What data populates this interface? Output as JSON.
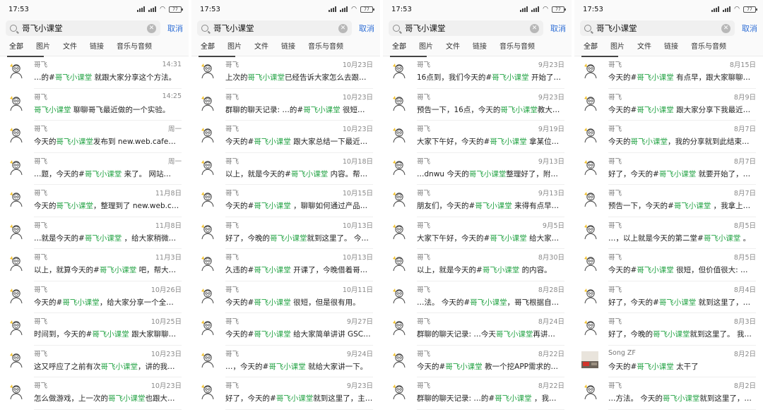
{
  "panels": [
    {
      "status_time": "17:53",
      "battery": "77",
      "search_value": "哥飞小课堂",
      "cancel_label": "取消",
      "tabs": [
        "全部",
        "图片",
        "文件",
        "链接",
        "音乐与音频"
      ],
      "items": [
        {
          "name": "哥飞",
          "time": "14:31",
          "pre": "…的#",
          "kw": "哥飞小课堂",
          "post": " 就跟大家分享这个方法。"
        },
        {
          "name": "哥飞",
          "time": "14:25",
          "pre": "",
          "kw": "哥飞小课堂",
          "post": " 聊聊哥飞最近做的一个实验。"
        },
        {
          "name": "哥飞",
          "time": "周一",
          "pre": "今天的",
          "kw": "哥飞小课堂",
          "post": "发布到 new.web.cafe…"
        },
        {
          "name": "哥飞",
          "time": "周一",
          "pre": "…题，今天的#",
          "kw": "哥飞小课堂",
          "post": " 来了。 网站…"
        },
        {
          "name": "哥飞",
          "time": "11月8日",
          "pre": "今天的",
          "kw": "哥飞小课堂",
          "post": "，整理到了 new.web.ca…"
        },
        {
          "name": "哥飞",
          "time": "11月8日",
          "pre": "…就是今天的#",
          "kw": "哥飞小课堂",
          "post": " ，给大家稍微…"
        },
        {
          "name": "哥飞",
          "time": "11月3日",
          "pre": "以上，就算今天的#",
          "kw": "哥飞小课堂",
          "post": " 吧，帮大…"
        },
        {
          "name": "哥飞",
          "time": "10月26日",
          "pre": "今天的#",
          "kw": "哥飞小课堂",
          "post": "，给大家分享一个全…"
        },
        {
          "name": "哥飞",
          "time": "10月25日",
          "pre": "时间到，今天的#",
          "kw": "哥飞小课堂",
          "post": " 跟大家聊聊…"
        },
        {
          "name": "哥飞",
          "time": "10月23日",
          "pre": "这又呼应了之前有次",
          "kw": "哥飞小课堂",
          "post": "，讲的我…"
        },
        {
          "name": "哥飞",
          "time": "10月23日",
          "pre": "怎么做游戏，上一次的",
          "kw": "哥飞小课堂",
          "post": "也跟大…"
        }
      ]
    },
    {
      "status_time": "17:53",
      "battery": "77",
      "search_value": "哥飞小课堂",
      "cancel_label": "取消",
      "tabs": [
        "全部",
        "图片",
        "文件",
        "链接",
        "音乐与音频"
      ],
      "items": [
        {
          "name": "哥飞",
          "time": "10月23日",
          "pre": "上次的",
          "kw": "哥飞小课堂",
          "post": "已经告诉大家怎么去跟…"
        },
        {
          "name": "哥飞",
          "time": "10月23日",
          "pre": "群聊的聊天记录: …的#",
          "kw": "哥飞小课堂",
          "post": " 很短…"
        },
        {
          "name": "哥飞",
          "time": "10月23日",
          "pre": "今天的#",
          "kw": "哥飞小课堂",
          "post": " 跟大家总结一下最近…"
        },
        {
          "name": "哥飞",
          "time": "10月18日",
          "pre": "以上，就是今天的#",
          "kw": "哥飞小课堂",
          "post": " 内容。帮…"
        },
        {
          "name": "哥飞",
          "time": "10月15日",
          "pre": "今天的#",
          "kw": "哥飞小课堂",
          "post": " ，聊聊如何通过产品…"
        },
        {
          "name": "哥飞",
          "time": "10月13日",
          "pre": "好了，今晚的",
          "kw": "哥飞小课堂",
          "post": "就到这里了。 今…"
        },
        {
          "name": "哥飞",
          "time": "10月13日",
          "pre": "久违的#",
          "kw": "哥飞小课堂",
          "post": " 开课了，今晚借着哥…"
        },
        {
          "name": "哥飞",
          "time": "10月11日",
          "pre": "今天的#",
          "kw": "哥飞小课堂",
          "post": " 很短，但是很有用。"
        },
        {
          "name": "哥飞",
          "time": "9月27日",
          "pre": "今天的#",
          "kw": "哥飞小课堂",
          "post": " 给大家简单讲讲 GSC…"
        },
        {
          "name": "哥飞",
          "time": "9月24日",
          "pre": "…，今天的#",
          "kw": "哥飞小课堂",
          "post": " 就给大家讲一下。"
        },
        {
          "name": "哥飞",
          "time": "9月23日",
          "pre": "好了，今天的#",
          "kw": "哥飞小课堂",
          "post": "就到这里了，主…"
        }
      ]
    },
    {
      "status_time": "17:53",
      "battery": "77",
      "search_value": "哥飞小课堂",
      "cancel_label": "取消",
      "tabs": [
        "全部",
        "图片",
        "文件",
        "链接",
        "音乐与音频"
      ],
      "items": [
        {
          "name": "哥飞",
          "time": "9月23日",
          "pre": "16点到，我们今天的#",
          "kw": "哥飞小课堂",
          "post": " 开始了…"
        },
        {
          "name": "哥飞",
          "time": "9月23日",
          "pre": "预告一下，16点，今天的",
          "kw": "哥飞小课堂",
          "post": "教大…"
        },
        {
          "name": "哥飞",
          "time": "9月19日",
          "pre": "大家下午好，今天的#",
          "kw": "哥飞小课堂",
          "post": " 拿某位…"
        },
        {
          "name": "哥飞",
          "time": "9月13日",
          "pre": "…dnwu 今天的",
          "kw": "哥飞小课堂",
          "post": "整理好了，附…"
        },
        {
          "name": "哥飞",
          "time": "9月13日",
          "pre": "朋友们，今天的#",
          "kw": "哥飞小课堂",
          "post": " 来得有点早…"
        },
        {
          "name": "哥飞",
          "time": "9月5日",
          "pre": "大家下午好，今天的#",
          "kw": "哥飞小课堂",
          "post": " 给大家分…"
        },
        {
          "name": "哥飞",
          "time": "8月30日",
          "pre": "以上，就是今天的#",
          "kw": "哥飞小课堂",
          "post": " 的内容。"
        },
        {
          "name": "哥飞",
          "time": "8月28日",
          "pre": "…法。 今天的#",
          "kw": "哥飞小课堂",
          "post": "，哥飞根据自…"
        },
        {
          "name": "哥飞",
          "time": "8月24日",
          "pre": "群聊的聊天记录: …今天",
          "kw": "哥飞小课堂",
          "post": "再讲…"
        },
        {
          "name": "哥飞",
          "time": "8月22日",
          "pre": "今天的#",
          "kw": "哥飞小课堂",
          "post": " 教一个挖APP需求的…"
        },
        {
          "name": "哥飞",
          "time": "8月22日",
          "pre": "群聊的聊天记录: …的#",
          "kw": "哥飞小课堂",
          "post": " ，我…"
        }
      ]
    },
    {
      "status_time": "17:53",
      "battery": "77",
      "search_value": "哥飞小课堂",
      "cancel_label": "取消",
      "tabs": [
        "全部",
        "图片",
        "文件",
        "链接",
        "音乐与音频"
      ],
      "items": [
        {
          "name": "哥飞",
          "time": "8月15日",
          "pre": "今天的#",
          "kw": "哥飞小课堂",
          "post": " 有点早，跟大家聊聊…"
        },
        {
          "name": "哥飞",
          "time": "8月9日",
          "pre": "今天的#",
          "kw": "哥飞小课堂",
          "post": " 跟大家分享下我最近…"
        },
        {
          "name": "哥飞",
          "time": "8月7日",
          "pre": "今天的",
          "kw": "哥飞小课堂",
          "post": "，我的分享就到此结束…"
        },
        {
          "name": "哥飞",
          "time": "8月7日",
          "pre": "好了，今天的#",
          "kw": "哥飞小课堂",
          "post": " 就要开始了，…"
        },
        {
          "name": "哥飞",
          "time": "8月7日",
          "pre": "预告一下，今天的#",
          "kw": "哥飞小课堂",
          "post": " ，我拿上午…"
        },
        {
          "name": "哥飞",
          "time": "8月5日",
          "pre": "…，以上就是今天的第二堂#",
          "kw": "哥飞小课堂",
          "post": " 。"
        },
        {
          "name": "哥飞",
          "time": "8月5日",
          "pre": "今天的#",
          "kw": "哥飞小课堂",
          "post": " 很短，但价值很大: …"
        },
        {
          "name": "哥飞",
          "time": "8月4日",
          "pre": "好了，今天的#",
          "kw": "哥飞小课堂",
          "post": " 就到这里了，…"
        },
        {
          "name": "哥飞",
          "time": "8月3日",
          "pre": "好了，今晚的",
          "kw": "哥飞小课堂",
          "post": "就到这里了。 我…"
        },
        {
          "name": "Song ZF",
          "time": "8月2日",
          "pre": "今天的#",
          "kw": "哥飞小课堂",
          "post": " 太干了",
          "photo": true
        },
        {
          "name": "哥飞",
          "time": "8月2日",
          "pre": "…方法。 今天的",
          "kw": "哥飞小课堂",
          "post": "就到这里了，…"
        }
      ]
    }
  ],
  "colors": {
    "highlight": "#23a344",
    "cancel": "#2f6fd6"
  },
  "icons": {
    "search": "search-icon",
    "clear": "clear-icon",
    "avatar": "sketch-avatar-icon"
  }
}
